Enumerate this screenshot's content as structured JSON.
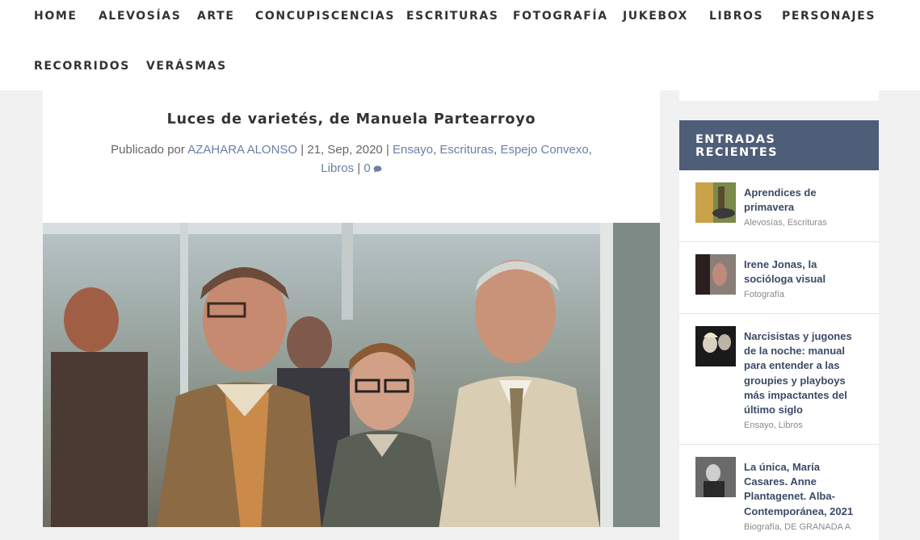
{
  "nav": {
    "items": [
      "HOME",
      "ALEVOSÍAS",
      "ARTE",
      "CONCUPISCENCIAS",
      "ESCRITURAS",
      "FOTOGRAFÍA",
      "JUKEBOX",
      "LIBROS",
      "PERSONAJES",
      "RECORRIDOS",
      "VERÁSMAS"
    ]
  },
  "post": {
    "title": "Luces de varietés, de Manuela Partearroyo",
    "published_by": "Publicado por",
    "author": "AZAHARA ALONSO",
    "date": "21, Sep, 2020",
    "categories": [
      "Ensayo",
      "Escrituras",
      "Espejo Convexo",
      "Libros"
    ],
    "comment_count": "0",
    "separator": "|"
  },
  "sidebar": {
    "recent_title": "ENTRADAS RECIENTES",
    "recent": [
      {
        "title": "Aprendices de primavera",
        "cats": "Alevosías, Escrituras"
      },
      {
        "title": "Irene Jonas, la socióloga visual",
        "cats": "Fotografía"
      },
      {
        "title": "Narcisistas y jugones de la noche: manual para entender a las groupies y playboys más impactantes del último siglo",
        "cats": "Ensayo, Libros"
      },
      {
        "title": "La única, María Casares. Anne Plantagenet. Alba-Contemporánea, 2021",
        "cats": "Biografía, DE GRANADA A"
      }
    ]
  },
  "colors": {
    "link": "#6b7fa8",
    "widget_header": "#4e5d78",
    "post_title_link": "#3b4a66"
  }
}
